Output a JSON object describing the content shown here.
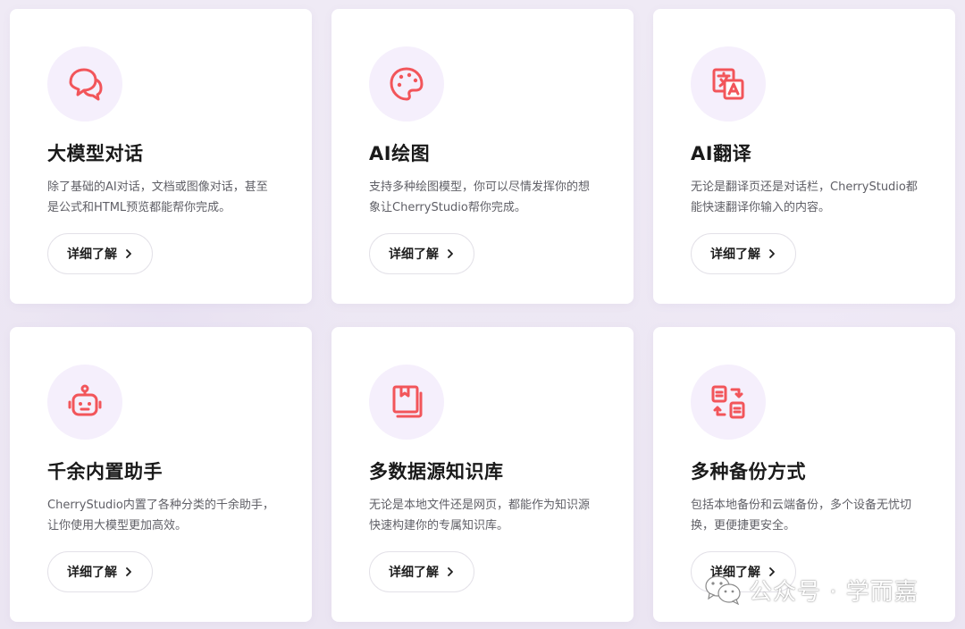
{
  "features": [
    {
      "icon": "chat-bubbles-icon",
      "title": "大模型对话",
      "desc_line1": "除了基础的AI对话，文档或图像对话，甚至",
      "desc_line2": "是公式和HTML预览都能帮你完成。",
      "button": "详细了解"
    },
    {
      "icon": "palette-icon",
      "title": "AI绘图",
      "desc_line1": "支持多种绘图模型，你可以尽情发挥你的想",
      "desc_line2": "象让CherryStudio帮你完成。",
      "button": "详细了解"
    },
    {
      "icon": "translate-icon",
      "title": "AI翻译",
      "desc_line1": "无论是翻译页还是对话栏，CherryStudio都",
      "desc_line2": "能快速翻译你输入的内容。",
      "button": "详细了解"
    },
    {
      "icon": "robot-icon",
      "title": "千余内置助手",
      "desc_line1": "CherryStudio内置了各种分类的千余助手，",
      "desc_line2": "让你使用大模型更加高效。",
      "button": "详细了解"
    },
    {
      "icon": "book-stack-icon",
      "title": "多数据源知识库",
      "desc_line1": "无论是本地文件还是网页，都能作为知识源",
      "desc_line2": "快速构建你的专属知识库。",
      "button": "详细了解"
    },
    {
      "icon": "backup-sync-icon",
      "title": "多种备份方式",
      "desc_line1": "包括本地备份和云端备份，多个设备无忧切",
      "desc_line2": "换，更便捷更安全。",
      "button": "详细了解"
    }
  ],
  "watermark": {
    "icon": "wechat-icon",
    "text": "公众号 · 学而嘉"
  },
  "colors": {
    "icon_accent": "#f2555a",
    "icon_bg": "#f5effc",
    "page_bg": "#ece7f3"
  }
}
